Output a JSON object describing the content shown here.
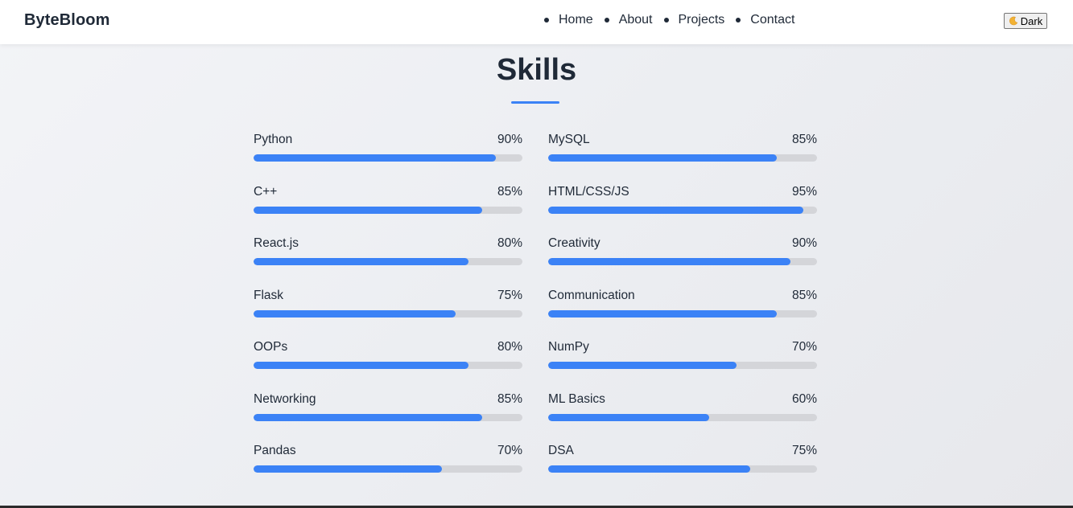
{
  "brand": "ByteBloom",
  "nav": {
    "links": [
      {
        "label": "Home"
      },
      {
        "label": "About"
      },
      {
        "label": "Projects"
      },
      {
        "label": "Contact"
      }
    ],
    "theme_toggle": {
      "icon": "moon-icon",
      "label": "Dark"
    }
  },
  "section": {
    "title": "Skills"
  },
  "colors": {
    "accent": "#3b82f6",
    "track": "#d4d5d9",
    "text": "#1f2937"
  },
  "skills": [
    {
      "name": "Python",
      "percent_label": "90%",
      "level": 90
    },
    {
      "name": "MySQL",
      "percent_label": "85%",
      "level": 85
    },
    {
      "name": "C++",
      "percent_label": "85%",
      "level": 85
    },
    {
      "name": "HTML/CSS/JS",
      "percent_label": "95%",
      "level": 95
    },
    {
      "name": "React.js",
      "percent_label": "80%",
      "level": 80
    },
    {
      "name": "Creativity",
      "percent_label": "90%",
      "level": 90
    },
    {
      "name": "Flask",
      "percent_label": "75%",
      "level": 75
    },
    {
      "name": "Communication",
      "percent_label": "85%",
      "level": 85
    },
    {
      "name": "OOPs",
      "percent_label": "80%",
      "level": 80
    },
    {
      "name": "NumPy",
      "percent_label": "70%",
      "level": 70
    },
    {
      "name": "Networking",
      "percent_label": "85%",
      "level": 85
    },
    {
      "name": "ML Basics",
      "percent_label": "60%",
      "level": 60
    },
    {
      "name": "Pandas",
      "percent_label": "70%",
      "level": 70
    },
    {
      "name": "DSA",
      "percent_label": "75%",
      "level": 75
    }
  ]
}
